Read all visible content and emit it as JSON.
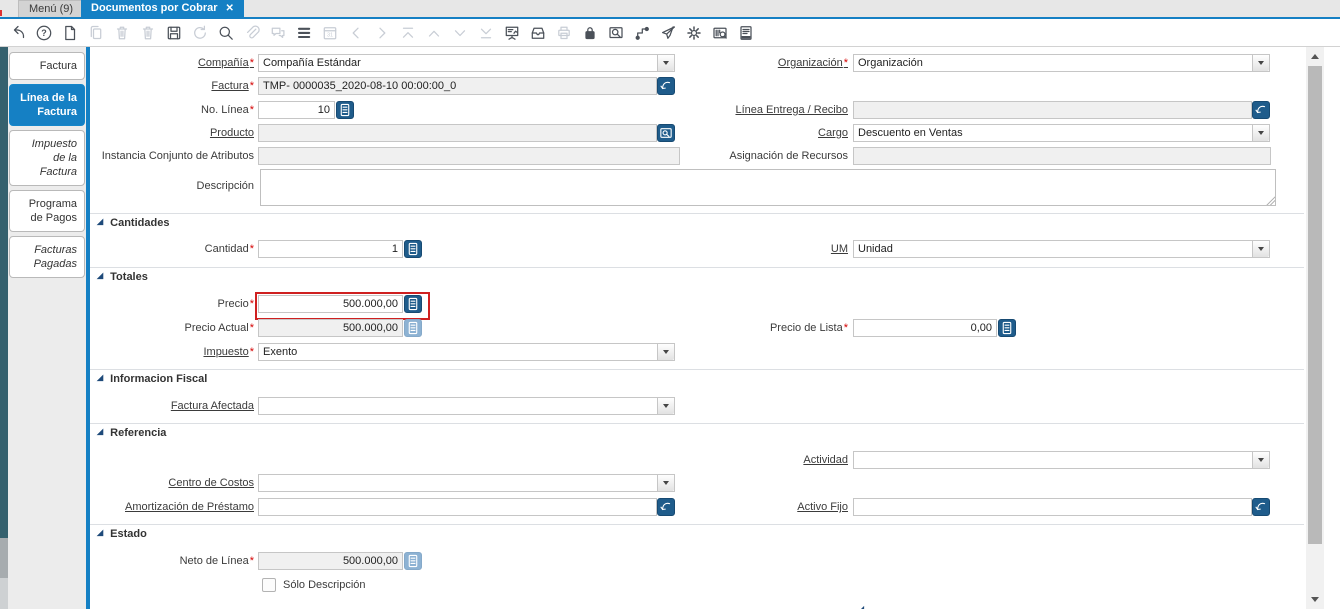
{
  "window": {
    "menu_tab": "Menú (9)",
    "doc_tab": "Documentos por Cobrar"
  },
  "colors": {
    "accent_blue": "#1580c4",
    "button_blue": "#1f5c8b",
    "focus_red": "#cf2020",
    "side_strip_teal": "#35616e",
    "readonly_gray": "#f0f0f0"
  },
  "toolbar": {
    "buttons": [
      {
        "name": "undo-icon",
        "icon": "undo",
        "enabled": true
      },
      {
        "name": "help-icon",
        "icon": "help",
        "enabled": true
      },
      {
        "name": "new-record-icon",
        "icon": "new",
        "enabled": true
      },
      {
        "name": "copy-record-icon",
        "icon": "copy",
        "enabled": false
      },
      {
        "name": "delete-record-icon",
        "icon": "del",
        "enabled": false
      },
      {
        "name": "delete-selection-icon",
        "icon": "del",
        "enabled": false
      },
      {
        "name": "save-icon",
        "icon": "save",
        "enabled": true
      },
      {
        "name": "refresh-icon",
        "icon": "refresh",
        "enabled": false
      },
      {
        "name": "find-icon",
        "icon": "find",
        "enabled": true
      },
      {
        "name": "attachment-icon",
        "icon": "clip",
        "enabled": false
      },
      {
        "name": "chat-icon",
        "icon": "chat",
        "enabled": false
      },
      {
        "name": "grid-toggle-icon",
        "icon": "grid",
        "enabled": true
      },
      {
        "name": "calendar-icon",
        "icon": "cal",
        "enabled": false
      },
      {
        "name": "previous-record-icon",
        "icon": "prev",
        "enabled": false
      },
      {
        "name": "next-record-icon",
        "icon": "next",
        "enabled": false
      },
      {
        "name": "first-record-icon",
        "icon": "first",
        "enabled": false
      },
      {
        "name": "parent-record-icon",
        "icon": "up",
        "enabled": false
      },
      {
        "name": "detail-record-icon",
        "icon": "down",
        "enabled": false
      },
      {
        "name": "last-record-icon",
        "icon": "last",
        "enabled": false
      },
      {
        "name": "report-viewer-icon",
        "icon": "rptview",
        "enabled": true
      },
      {
        "name": "archive-icon",
        "icon": "archive",
        "enabled": true
      },
      {
        "name": "print-icon",
        "icon": "print",
        "enabled": false
      },
      {
        "name": "lock-icon",
        "icon": "lock",
        "enabled": true
      },
      {
        "name": "zoom-across-icon",
        "icon": "zoomw",
        "enabled": true
      },
      {
        "name": "workflow-icon",
        "icon": "wf",
        "enabled": true
      },
      {
        "name": "send-icon",
        "icon": "send",
        "enabled": true
      },
      {
        "name": "preferences-icon",
        "icon": "gear",
        "enabled": true
      },
      {
        "name": "product-info-icon",
        "icon": "scan",
        "enabled": true
      },
      {
        "name": "report-icon",
        "icon": "rpt",
        "enabled": true
      }
    ]
  },
  "sidebar": {
    "tabs": [
      {
        "id": "factura",
        "label": "Factura",
        "active": false,
        "italic": false
      },
      {
        "id": "linea-de-la-factura",
        "label": "Línea de la Factura",
        "active": true,
        "italic": false
      },
      {
        "id": "impuesto-de-la-factura",
        "label": "Impuesto de la Factura",
        "active": false,
        "italic": true
      },
      {
        "id": "programa-de-pagos",
        "label": "Programa de Pagos",
        "active": false,
        "italic": false
      },
      {
        "id": "facturas-pagadas",
        "label": "Facturas Pagadas",
        "active": false,
        "italic": true
      }
    ]
  },
  "form": {
    "req": "*",
    "sections": {
      "quantities": "Cantidades",
      "amounts": "Totales",
      "fiscal": "Informacion Fiscal",
      "reference": "Referencia",
      "status": "Estado"
    },
    "fields": {
      "company": {
        "label": "Compañía",
        "value": "Compañía Estándar"
      },
      "organization": {
        "label": "Organización",
        "value": "Organización"
      },
      "invoice": {
        "label": "Factura",
        "value": "TMP- 0000035_2020-08-10 00:00:00_0"
      },
      "line_no": {
        "label": "No. Línea",
        "value": "10"
      },
      "shipment_line": {
        "label": "Línea Entrega / Recibo",
        "value": ""
      },
      "product": {
        "label": "Producto",
        "value": ""
      },
      "charge": {
        "label": "Cargo",
        "value": "Descuento en Ventas"
      },
      "attribute_instance": {
        "label": "Instancia Conjunto de Atributos",
        "value": ""
      },
      "resource_assignment": {
        "label": "Asignación de Recursos",
        "value": ""
      },
      "description": {
        "label": "Descripción",
        "value": ""
      },
      "quantity": {
        "label": "Cantidad",
        "value": "1"
      },
      "uom": {
        "label": "UM",
        "value": "Unidad"
      },
      "price": {
        "label": "Precio",
        "value": "500.000,00"
      },
      "price_actual": {
        "label": "Precio Actual",
        "value": "500.000,00"
      },
      "price_list": {
        "label": "Precio de Lista",
        "value": "0,00"
      },
      "tax": {
        "label": "Impuesto",
        "value": "Exento"
      },
      "affected_invoice": {
        "label": "Factura Afectada",
        "value": ""
      },
      "activity": {
        "label": "Actividad",
        "value": ""
      },
      "cost_center": {
        "label": "Centro de Costos",
        "value": ""
      },
      "loan_amortization": {
        "label": "Amortización de Préstamo",
        "value": ""
      },
      "fixed_asset": {
        "label": "Activo Fijo",
        "value": ""
      },
      "line_net": {
        "label": "Neto de Línea",
        "value": "500.000,00"
      },
      "description_only": {
        "label": "Sólo Descripción",
        "checked": false
      }
    }
  }
}
